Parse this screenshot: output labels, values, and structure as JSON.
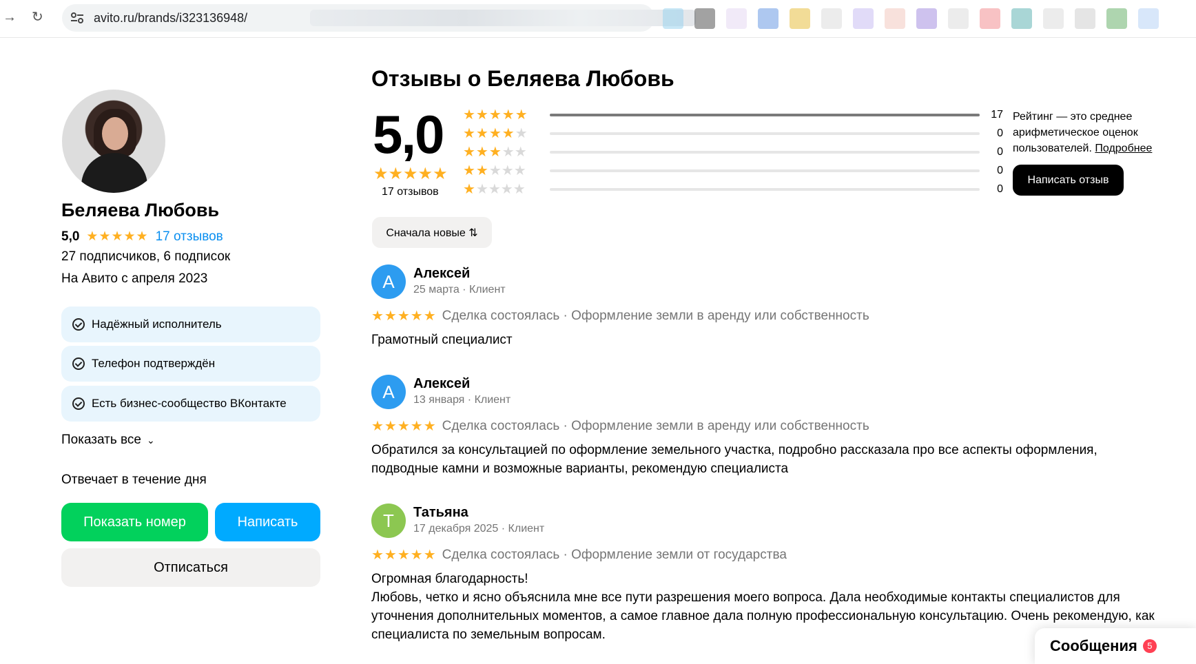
{
  "browser": {
    "url": "avito.ru/brands/i323136948/",
    "back_icon": "→",
    "reload_icon": "↻",
    "extension_colors": [
      "#9ad4ef",
      "#555555",
      "#e5d8f3",
      "#6c9be3",
      "#e8c042",
      "#dddddd",
      "#c8bdf2",
      "#f2c9bf",
      "#a590e0",
      "#dddddd",
      "#f28f93",
      "#62b5b5",
      "#dddddd",
      "#cfcfcf",
      "#6bb26d",
      "#b8d3f5"
    ]
  },
  "profile": {
    "name": "Беляева Любовь",
    "rating": "5,0",
    "stars": "★★★★★",
    "reviews_link": "17 отзывов",
    "followers": "27 подписчиков, 6 подписок",
    "since": "На Авито с апреля 2023",
    "badges": [
      "Надёжный исполнитель",
      "Телефон подтверждён",
      "Есть бизнес-сообщество ВКонтакте"
    ],
    "show_all": "Показать все",
    "responds": "Отвечает в течение дня",
    "show_number_button": "Показать номер",
    "write_button": "Написать",
    "unsubscribe_button": "Отписаться"
  },
  "reviews_section": {
    "title": "Отзывы о Беляева Любовь",
    "average": "5,0",
    "average_stars": "★★★★★",
    "count_label": "17 отзывов",
    "distribution": [
      {
        "filled": "★★★★★",
        "empty": "",
        "count": "17",
        "fraction": 1.0
      },
      {
        "filled": "★★★★",
        "empty": "★",
        "count": "0",
        "fraction": 0
      },
      {
        "filled": "★★★",
        "empty": "★★",
        "count": "0",
        "fraction": 0
      },
      {
        "filled": "★★",
        "empty": "★★★",
        "count": "0",
        "fraction": 0
      },
      {
        "filled": "★",
        "empty": "★★★★",
        "count": "0",
        "fraction": 0
      }
    ],
    "rating_note": "Рейтинг — это среднее арифметическое оценок пользователей.",
    "rating_note_link": "Подробнее",
    "write_review_button": "Написать отзыв",
    "sort_button": "Сначала новые ⇅"
  },
  "reviews": [
    {
      "initial": "А",
      "avatar_color": "#2d9cf0",
      "name": "Алексей",
      "date": "25 марта · Клиент",
      "stars": "★★★★★",
      "deal": "Сделка состоялась · Оформление земли в аренду или собственность",
      "text": "Грамотный специалист"
    },
    {
      "initial": "А",
      "avatar_color": "#2d9cf0",
      "name": "Алексей",
      "date": "13 января · Клиент",
      "stars": "★★★★★",
      "deal": "Сделка состоялась · Оформление земли в аренду или собственность",
      "text": "Обратился за консультацией по оформление земельного участка, подробно рассказала про все аспекты оформления, подводные камни и возможные варианты, рекомендую специалиста"
    },
    {
      "initial": "Т",
      "avatar_color": "#8cc751",
      "name": "Татьяна",
      "date": "17 декабря 2025 · Клиент",
      "stars": "★★★★★",
      "deal": "Сделка состоялась · Оформление земли от государства",
      "text_line1": "Огромная благодарность!",
      "text": "Любовь, четко и ясно объяснила мне все пути разрешения моего вопроса. Дала необходимые контакты специалистов для уточнения дополнительных моментов, а самое главное дала полную профессиональную консультацию. Очень рекомендую, как специалиста по земельным вопросам."
    }
  ],
  "messages_widget": {
    "label": "Сообщения",
    "badge": "5"
  }
}
